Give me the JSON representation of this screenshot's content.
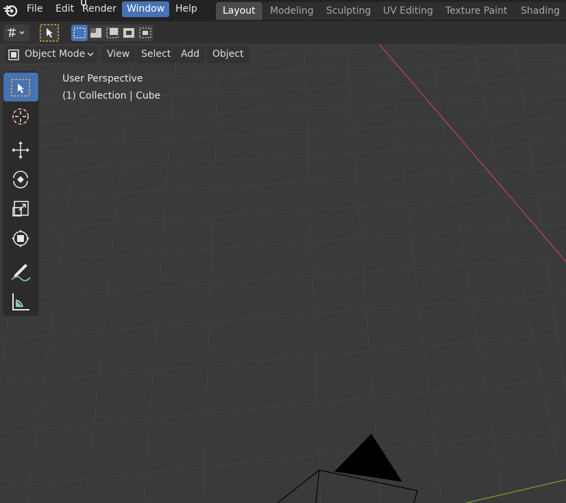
{
  "menu": {
    "file": "File",
    "edit": "Edit",
    "render": "Render",
    "window": "Window",
    "help": "Help"
  },
  "workspaces": [
    "Layout",
    "Modeling",
    "Sculpting",
    "UV Editing",
    "Texture Paint",
    "Shading"
  ],
  "viewport_header": {
    "mode": "Object Mode",
    "view": "View",
    "select": "Select",
    "add": "Add",
    "object": "Object"
  },
  "overlay": {
    "perspective": "User Perspective",
    "collection": "(1) Collection | Cube"
  },
  "colors": {
    "accent": "#4772b3",
    "x_axis": "#c04552",
    "y_axis": "#7da32a",
    "grid": "#434343",
    "background": "#3a3a3a"
  },
  "tools": [
    "select-box-tool",
    "cursor-tool",
    "move-tool",
    "rotate-tool",
    "scale-tool",
    "transform-tool",
    "annotate-tool",
    "measure-tool"
  ]
}
